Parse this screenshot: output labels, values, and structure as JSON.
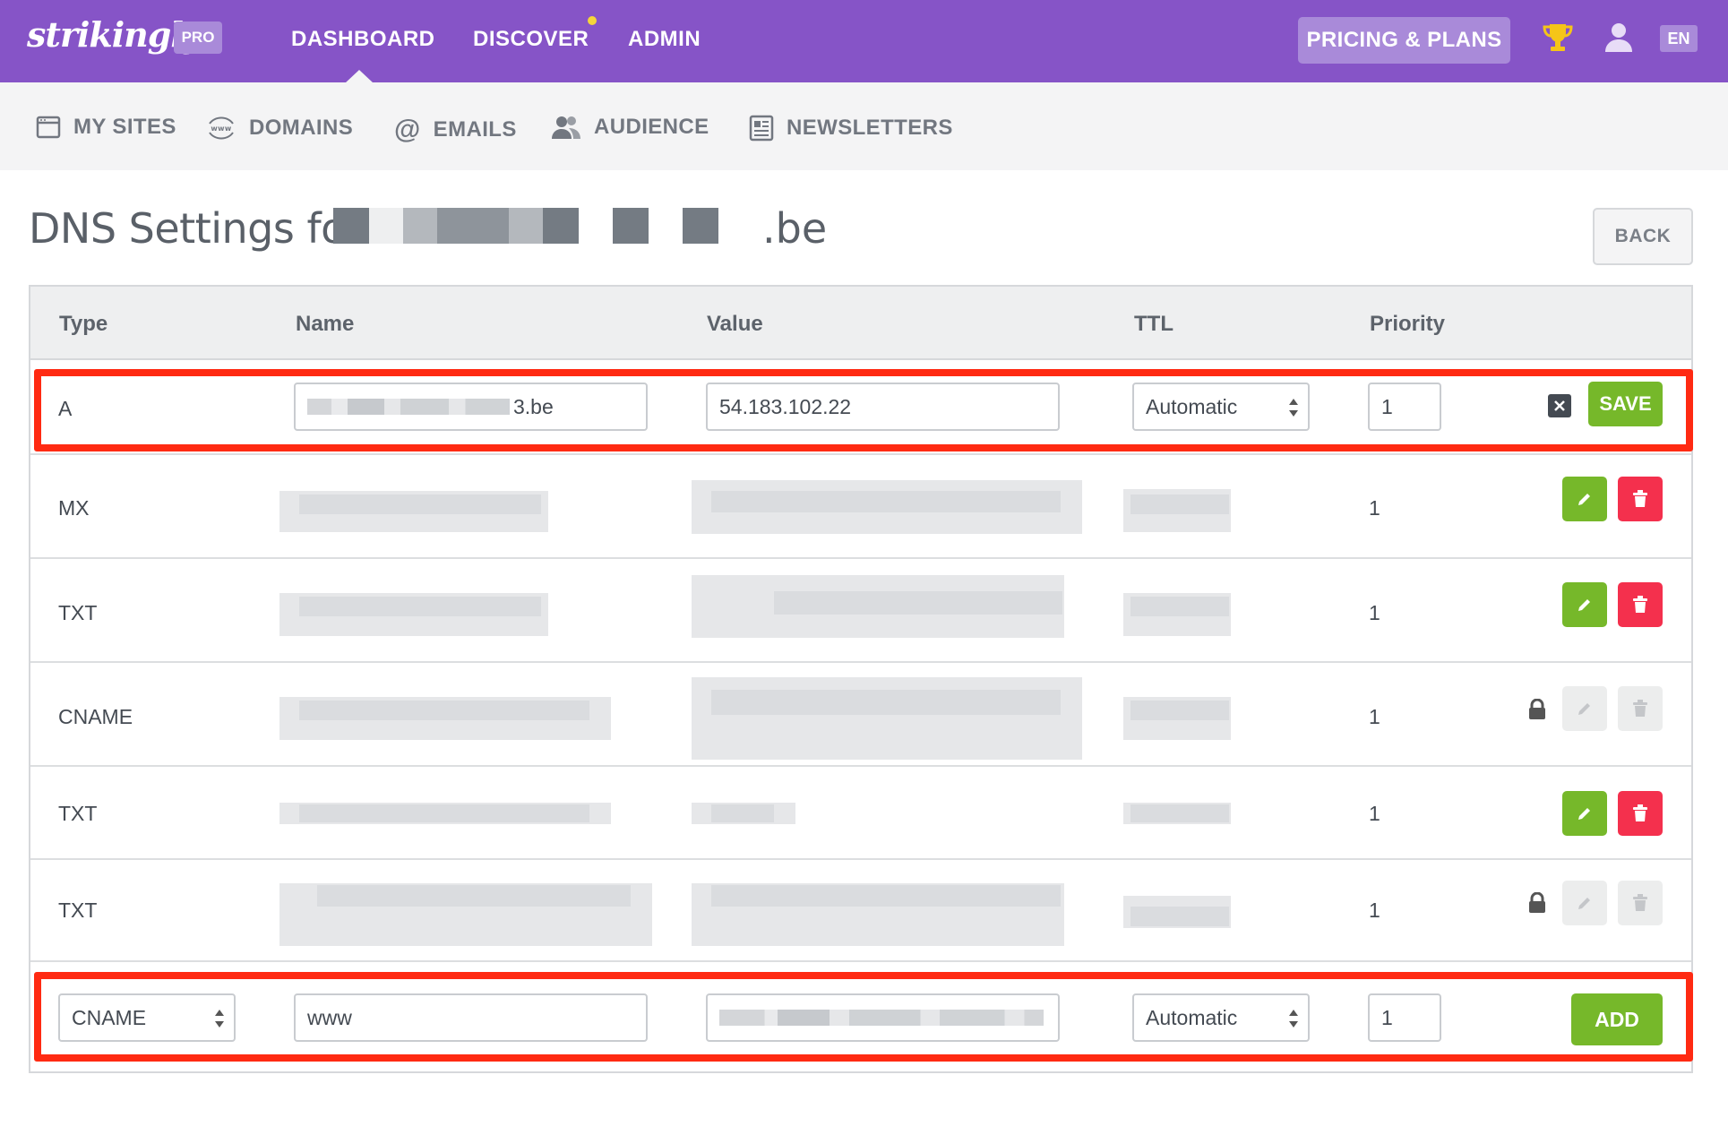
{
  "topbar": {
    "logo": "strikingly",
    "badge": "PRO",
    "nav": [
      "DASHBOARD",
      "DISCOVER",
      "ADMIN"
    ],
    "pricing_label": "PRICING & PLANS",
    "language": "EN",
    "icons": {
      "trophy": "trophy-icon",
      "user": "user-icon"
    }
  },
  "subnav": {
    "items": [
      {
        "label": "MY SITES",
        "icon": "browser-window-icon"
      },
      {
        "label": "DOMAINS",
        "icon": "www-globe-icon"
      },
      {
        "label": "EMAILS",
        "icon": "at-sign-icon"
      },
      {
        "label": "AUDIENCE",
        "icon": "people-icon"
      },
      {
        "label": "NEWSLETTERS",
        "icon": "newsletter-icon"
      }
    ]
  },
  "page": {
    "title": "DNS Settings for",
    "domain_suffix": ".be",
    "back_label": "BACK"
  },
  "table": {
    "headers": [
      "Type",
      "Name",
      "Value",
      "TTL",
      "Priority"
    ],
    "edit_row": {
      "type": "A",
      "name_suffix": "3.be",
      "value": "54.183.102.22",
      "ttl": "Automatic",
      "priority": "1",
      "save_label": "SAVE"
    },
    "rows": [
      {
        "type": "MX",
        "priority": "1",
        "locked": false
      },
      {
        "type": "TXT",
        "priority": "1",
        "locked": false
      },
      {
        "type": "CNAME",
        "priority": "1",
        "locked": true
      },
      {
        "type": "TXT",
        "priority": "1",
        "locked": false
      },
      {
        "type": "TXT",
        "priority": "1",
        "locked": true
      }
    ],
    "add_row": {
      "type": "CNAME",
      "name": "www",
      "ttl": "Automatic",
      "priority": "1",
      "add_label": "ADD"
    }
  },
  "colors": {
    "brand_purple": "#8654c7",
    "save_green": "#76b82a",
    "delete_red": "#f4304d",
    "highlight_red": "#ff2a12"
  }
}
